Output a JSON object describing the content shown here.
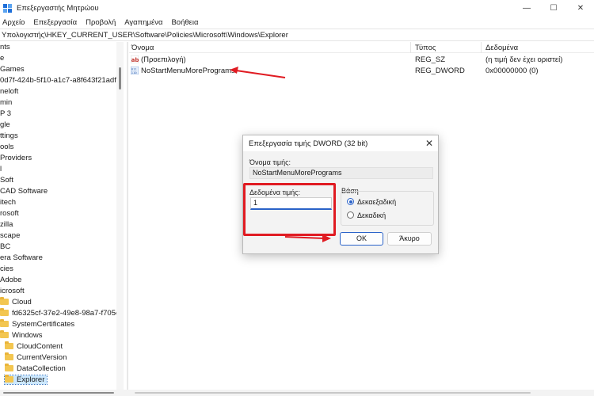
{
  "window": {
    "title": "Επεξεργαστής Μητρώου",
    "minimize": "—",
    "maximize": "☐",
    "close": "✕"
  },
  "menu": [
    "Αρχείο",
    "Επεξεργασία",
    "Προβολή",
    "Αγαπημένα",
    "Βοήθεια"
  ],
  "address": "Υπολογιστής\\HKEY_CURRENT_USER\\Software\\Policies\\Microsoft\\Windows\\Explorer",
  "tree": [
    {
      "label": "nts",
      "indent": 0,
      "folder": false
    },
    {
      "label": "e",
      "indent": 0,
      "folder": false
    },
    {
      "label": " Games",
      "indent": 0,
      "folder": false
    },
    {
      "label": "0d7f-424b-5f10-a1c7-a8f643f21adf",
      "indent": 0,
      "folder": false
    },
    {
      "label": "neloft",
      "indent": 0,
      "folder": false
    },
    {
      "label": "min",
      "indent": 0,
      "folder": false
    },
    {
      "label": "P 3",
      "indent": 0,
      "folder": false
    },
    {
      "label": "gle",
      "indent": 0,
      "folder": false
    },
    {
      "label": "ttings",
      "indent": 0,
      "folder": false
    },
    {
      "label": "ools",
      "indent": 0,
      "folder": false
    },
    {
      "label": "Providers",
      "indent": 0,
      "folder": false
    },
    {
      "label": "l",
      "indent": 0,
      "folder": false
    },
    {
      "label": "Soft",
      "indent": 0,
      "folder": false
    },
    {
      "label": "CAD Software",
      "indent": 0,
      "folder": false
    },
    {
      "label": "itech",
      "indent": 0,
      "folder": false
    },
    {
      "label": "rosoft",
      "indent": 0,
      "folder": false
    },
    {
      "label": "zilla",
      "indent": 0,
      "folder": false
    },
    {
      "label": "scape",
      "indent": 0,
      "folder": false
    },
    {
      "label": "BC",
      "indent": 0,
      "folder": false
    },
    {
      "label": "era Software",
      "indent": 0,
      "folder": false
    },
    {
      "label": "cies",
      "indent": 0,
      "folder": false
    },
    {
      "label": "Adobe",
      "indent": 0,
      "folder": false
    },
    {
      "label": "icrosoft",
      "indent": 0,
      "folder": false
    },
    {
      "label": "Cloud",
      "indent": 1,
      "folder": true
    },
    {
      "label": "fd6325cf-37e2-49e8-98a7-f705e2",
      "indent": 1,
      "folder": true
    },
    {
      "label": "SystemCertificates",
      "indent": 1,
      "folder": true
    },
    {
      "label": "Windows",
      "indent": 1,
      "folder": true
    },
    {
      "label": "CloudContent",
      "indent": 2,
      "folder": true
    },
    {
      "label": "CurrentVersion",
      "indent": 2,
      "folder": true
    },
    {
      "label": "DataCollection",
      "indent": 2,
      "folder": true
    },
    {
      "label": "Explorer",
      "indent": 2,
      "folder": true,
      "selected": true
    }
  ],
  "list": {
    "columns": [
      "Όνομα",
      "Τύπος",
      "Δεδομένα"
    ],
    "rows": [
      {
        "name": "(Προεπιλογή)",
        "type": "REG_SZ",
        "data": "(η τιμή δεν έχει οριστεί)",
        "icon": "string-value-icon"
      },
      {
        "name": "NoStartMenuMorePrograms",
        "type": "REG_DWORD",
        "data": "0x00000000 (0)",
        "icon": "dword-value-icon"
      }
    ]
  },
  "dialog": {
    "title": "Επεξεργασία τιμής DWORD (32 bit)",
    "close": "✕",
    "name_label": "Όνομα τιμής:",
    "name_value": "NoStartMenuMorePrograms",
    "data_label": "Δεδομένα τιμής:",
    "data_value": "1",
    "base_label": "Βάση",
    "base_options": [
      {
        "label": "Δεκαεξαδική",
        "checked": true
      },
      {
        "label": "Δεκαδική",
        "checked": false
      }
    ],
    "ok": "OK",
    "cancel": "Άκυρο"
  },
  "colors": {
    "annotation_red": "#e01b22",
    "accent_blue": "#2a62c8",
    "selection": "#cce8ff"
  }
}
